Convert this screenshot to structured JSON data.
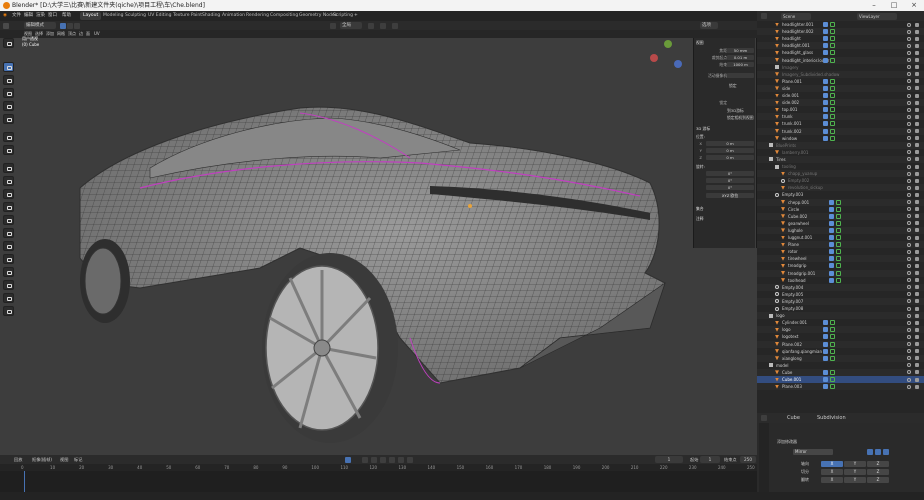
{
  "titlebar": {
    "title": "Blender* [D:\\大学三\\比赛\\新建文件夹(qiche)\\项目工程\\车\\Che.blend]"
  },
  "menu": {
    "items": [
      "文件",
      "编辑",
      "渲染",
      "窗口",
      "帮助"
    ],
    "workspaces": [
      "Layout",
      "Modeling",
      "Sculpting",
      "UV Editing",
      "Texture Paint",
      "Shading",
      "Animation",
      "Rendering",
      "Compositing",
      "Geometry Nodes",
      "Scripting"
    ],
    "active_workspace": "Layout"
  },
  "viewport_header": {
    "mode": "编辑模式",
    "menus": [
      "视图",
      "选择",
      "添加",
      "网格",
      "顶点",
      "边",
      "面",
      "UV"
    ],
    "transform": "全局",
    "overlay_label": "选项"
  },
  "viewport_info": {
    "view_name": "用户透视",
    "object_name": "(0) Cube"
  },
  "npanel": {
    "tabs": [
      "项",
      "工具",
      "视图"
    ],
    "view_section": "视图",
    "focal_label": "焦距",
    "focal_value": "50 mm",
    "clip_start_label": "裁剪起点",
    "clip_start_value": "0.01 m",
    "clip_end_label": "结束",
    "clip_end_value": "1000 m",
    "local_camera_label": "活动摄像机",
    "local_camera_value": "",
    "lock_label": "锁定",
    "lock_to_cursor": "到3D游标",
    "lock_camera": "锁定相机到视图",
    "cursor_section": "3D 游标",
    "location_label": "位置:",
    "x_label": "X",
    "x_value": "0 m",
    "y_label": "Y",
    "y_value": "0 m",
    "z_label": "Z",
    "z_value": "0 m",
    "rotation_label": "旋转:",
    "rx_value": "0°",
    "ry_value": "0°",
    "rz_value": "0°",
    "rot_mode": "XYZ 欧拉",
    "collections_section": "集合",
    "annotations_section": "注释"
  },
  "timeline": {
    "menus": [
      "回放",
      "抠像(插帧)",
      "视图",
      "标记"
    ],
    "current_frame": "1",
    "start_label": "起始",
    "start_value": "1",
    "end_label": "结束点",
    "end_value": "250",
    "ticks": [
      "0",
      "10",
      "20",
      "30",
      "40",
      "50",
      "60",
      "70",
      "80",
      "90",
      "100",
      "110",
      "120",
      "130",
      "140",
      "150",
      "160",
      "170",
      "180",
      "190",
      "200",
      "210",
      "220",
      "230",
      "240",
      "250"
    ]
  },
  "outliner": {
    "header": "Scene",
    "view_layer": "ViewLayer",
    "rows": [
      {
        "name": "headlighter.001",
        "type": "mesh",
        "depth": 2
      },
      {
        "name": "headlighter.002",
        "type": "mesh",
        "depth": 2
      },
      {
        "name": "headlight",
        "type": "mesh",
        "depth": 2
      },
      {
        "name": "headlight.001",
        "type": "mesh",
        "depth": 2
      },
      {
        "name": "headlight_glass",
        "type": "mesh",
        "depth": 2
      },
      {
        "name": "headlight_interior.lower",
        "type": "mesh",
        "depth": 2
      },
      {
        "name": "Imagery",
        "type": "coll",
        "depth": 2,
        "faded": true
      },
      {
        "name": "Imagery_Subdivided.shadow",
        "type": "mesh",
        "depth": 2,
        "faded": true
      },
      {
        "name": "Plane.001",
        "type": "mesh",
        "depth": 2
      },
      {
        "name": "side",
        "type": "mesh",
        "depth": 2
      },
      {
        "name": "side.001",
        "type": "mesh",
        "depth": 2
      },
      {
        "name": "side.002",
        "type": "mesh",
        "depth": 2
      },
      {
        "name": "top.001",
        "type": "mesh",
        "depth": 2
      },
      {
        "name": "trunk",
        "type": "mesh",
        "depth": 2
      },
      {
        "name": "trunk.001",
        "type": "mesh",
        "depth": 2
      },
      {
        "name": "trunk.002",
        "type": "mesh",
        "depth": 2
      },
      {
        "name": "window",
        "type": "mesh",
        "depth": 2
      },
      {
        "name": "BluePrints",
        "type": "coll",
        "depth": 1,
        "faded": true
      },
      {
        "name": "lamberry.001",
        "type": "mesh",
        "depth": 2,
        "faded": true
      },
      {
        "name": "Tires",
        "type": "coll",
        "depth": 1
      },
      {
        "name": "tooling",
        "type": "coll",
        "depth": 2,
        "faded": true
      },
      {
        "name": "chapp_yuanup",
        "type": "mesh",
        "depth": 3,
        "faded": true
      },
      {
        "name": "Empty.002",
        "type": "empty",
        "depth": 3,
        "faded": true
      },
      {
        "name": "revolution_sickup",
        "type": "mesh",
        "depth": 3,
        "faded": true
      },
      {
        "name": "Empty.003",
        "type": "empty",
        "depth": 2
      },
      {
        "name": "chepp.001",
        "type": "mesh",
        "depth": 3
      },
      {
        "name": "Circle",
        "type": "mesh",
        "depth": 3
      },
      {
        "name": "Cube.002",
        "type": "mesh",
        "depth": 3
      },
      {
        "name": "gearwheel",
        "type": "mesh",
        "depth": 3
      },
      {
        "name": "lughole",
        "type": "mesh",
        "depth": 3
      },
      {
        "name": "luggnut.001",
        "type": "mesh",
        "depth": 3
      },
      {
        "name": "Plane",
        "type": "mesh",
        "depth": 3
      },
      {
        "name": "rotor",
        "type": "mesh",
        "depth": 3
      },
      {
        "name": "tirewheel",
        "type": "mesh",
        "depth": 3
      },
      {
        "name": "treadgrip",
        "type": "mesh",
        "depth": 3
      },
      {
        "name": "treadgrip.001",
        "type": "mesh",
        "depth": 3
      },
      {
        "name": "toolhead",
        "type": "mesh",
        "depth": 3
      },
      {
        "name": "Empty.004",
        "type": "empty",
        "depth": 2
      },
      {
        "name": "Empty.005",
        "type": "empty",
        "depth": 2
      },
      {
        "name": "Empty.007",
        "type": "empty",
        "depth": 2
      },
      {
        "name": "Empty.008",
        "type": "empty",
        "depth": 2
      },
      {
        "name": "logo",
        "type": "coll",
        "depth": 1
      },
      {
        "name": "Cylinder.001",
        "type": "mesh",
        "depth": 2
      },
      {
        "name": "logo",
        "type": "mesh",
        "depth": 2
      },
      {
        "name": "logotext",
        "type": "mesh",
        "depth": 2
      },
      {
        "name": "Plane.002",
        "type": "mesh",
        "depth": 2
      },
      {
        "name": "qianfang.qiangmian",
        "type": "mesh",
        "depth": 2
      },
      {
        "name": "xianglong",
        "type": "mesh",
        "depth": 2
      },
      {
        "name": "model",
        "type": "coll",
        "depth": 1
      },
      {
        "name": "Cube",
        "type": "mesh",
        "depth": 2
      },
      {
        "name": "Cube.001",
        "type": "mesh",
        "depth": 2,
        "selected": true
      },
      {
        "name": "Plane.003",
        "type": "mesh",
        "depth": 2
      }
    ]
  },
  "properties": {
    "object": "Cube",
    "modifier_name": "Subdivision",
    "add_modifier_label": "添加修改器",
    "mirror_label": "Mirror",
    "axis_label": "轴向",
    "bisect_label": "切分",
    "flip_label": "翻转",
    "axes": [
      "X",
      "Y",
      "Z"
    ]
  },
  "colors": {
    "accent": "#4772b3",
    "mesh_icon": "#e0883a",
    "selected_row": "#334d80",
    "crease_edge": "#c040c0"
  }
}
